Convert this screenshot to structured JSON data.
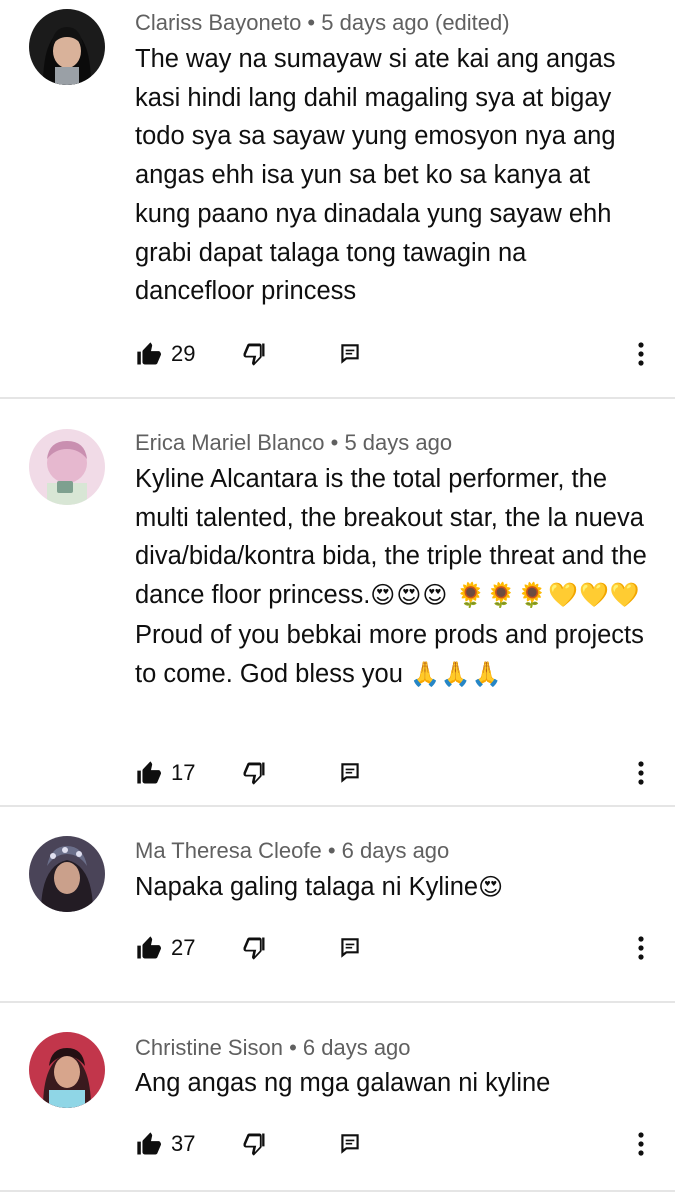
{
  "comments": [
    {
      "author": "Clariss Bayoneto",
      "age": "5 days ago (edited)",
      "text": "The way na sumayaw si ate kai ang angas kasi hindi lang dahil magaling sya at bigay todo sya sa sayaw yung emosyon nya ang angas ehh isa yun sa bet ko sa kanya at kung paano nya dinadala yung sayaw ehh grabi dapat talaga tong tawagin na dancefloor princess",
      "likes": "29",
      "avatar_color": "#1b1b1b"
    },
    {
      "author": "Erica Mariel Blanco",
      "age": "5 days ago",
      "text_part1": "Kyline Alcantara is the total performer, the multi talented, the breakout star, the la nueva diva/bida/kontra bida, the triple threat and the dance floor princess.",
      "emoji1": "😍😍😍",
      "emoji2": "🌻🌻🌻💛💛💛",
      "text_part2": " Proud of you bebkai more prods and projects to come. God bless you ",
      "emoji3": "🙏🙏🙏",
      "likes": "17",
      "avatar_color": "#e8b9d6"
    },
    {
      "author": "Ma Theresa Cleofe",
      "age": "6 days ago",
      "text": "Napaka galing talaga ni Kyline",
      "emoji": "😍",
      "likes": "27",
      "avatar_color": "#3a3140"
    },
    {
      "author": "Christine Sison",
      "age": "6 days ago",
      "text": "Ang angas ng mga galawan ni kyline",
      "likes": "37",
      "avatar_color": "#c2364b"
    }
  ],
  "separator": " • ",
  "icons": {
    "like": "thumb-up-icon",
    "dislike": "thumb-down-icon",
    "reply": "reply-comment-icon",
    "more": "more-vertical-icon"
  }
}
